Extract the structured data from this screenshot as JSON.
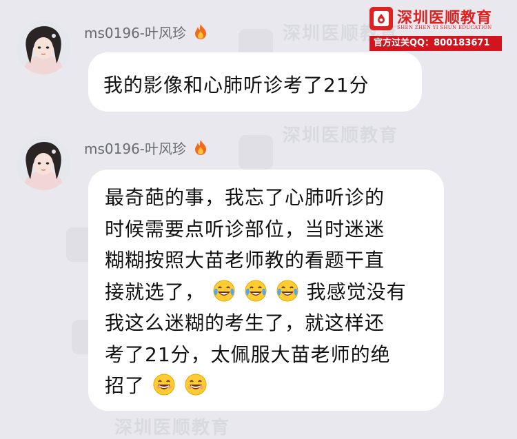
{
  "brand": {
    "name": "深圳医顺教育",
    "subtitle": "SHEN ZHEN YI SHUN EDUCATION",
    "qq_banner": "官方过关QQ：800183671"
  },
  "watermark": {
    "text": "深圳医顺教育"
  },
  "messages": [
    {
      "username": "ms0196-叶风珍",
      "text": "我的影像和心肺听诊考了21分"
    },
    {
      "username": "ms0196-叶风珍",
      "lines": [
        "最奇葩的事，我忘了心肺听诊的",
        "时候需要点听诊部位，当时迷迷",
        "糊糊按照大苗老师教的看题干直",
        "接就选了，",
        "我感觉没有",
        "我这么迷糊的考生了，就这样还",
        "考了21分，太佩服大苗老师的绝",
        "招了"
      ]
    }
  ],
  "colors": {
    "brand_red": "#d22222",
    "background": "#e8e8ee",
    "bubble": "#ffffff"
  },
  "icons": {
    "fire": "fire-icon",
    "laugh_cry": "tears-of-joy-emoji",
    "grin": "grinning-emoji"
  }
}
